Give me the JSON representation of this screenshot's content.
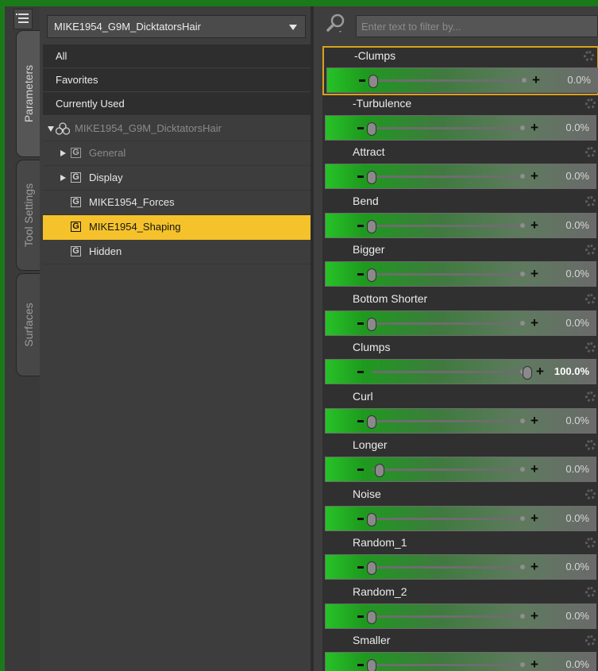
{
  "sidetabs": {
    "tabs": [
      {
        "label": "Parameters",
        "active": true
      },
      {
        "label": "Tool Settings",
        "active": false
      },
      {
        "label": "Surfaces",
        "active": false
      }
    ]
  },
  "left_panel": {
    "node_select": {
      "value": "MIKE1954_G9M_DicktatorsHair"
    },
    "nav": [
      {
        "label": "All"
      },
      {
        "label": "Favorites"
      },
      {
        "label": "Currently Used"
      }
    ],
    "tree": {
      "root": {
        "label": "MIKE1954_G9M_DicktatorsHair"
      },
      "groups": [
        {
          "label": "General",
          "expandable": true,
          "dim": true,
          "selected": false
        },
        {
          "label": "Display",
          "expandable": true,
          "dim": false,
          "selected": false
        },
        {
          "label": "MIKE1954_Forces",
          "expandable": false,
          "dim": false,
          "selected": false
        },
        {
          "label": "MIKE1954_Shaping",
          "expandable": false,
          "dim": false,
          "selected": true
        },
        {
          "label": "Hidden",
          "expandable": false,
          "dim": false,
          "selected": false
        }
      ],
      "group_icon": "G"
    }
  },
  "right_panel": {
    "filter": {
      "placeholder": "Enter text to filter by...",
      "value": ""
    },
    "params": [
      {
        "name": "-Clumps",
        "value": "0.0%",
        "level": 0.0,
        "highlighted": true
      },
      {
        "name": "-Turbulence",
        "value": "0.0%",
        "level": 0.0,
        "highlighted": false
      },
      {
        "name": "Attract",
        "value": "0.0%",
        "level": 0.0,
        "highlighted": false
      },
      {
        "name": "Bend",
        "value": "0.0%",
        "level": 0.0,
        "highlighted": false
      },
      {
        "name": "Bigger",
        "value": "0.0%",
        "level": 0.0,
        "highlighted": false
      },
      {
        "name": "Bottom Shorter",
        "value": "0.0%",
        "level": 0.0,
        "highlighted": false
      },
      {
        "name": "Clumps",
        "value": "100.0%",
        "level": 1.0,
        "highlighted": false
      },
      {
        "name": "Curl",
        "value": "0.0%",
        "level": 0.0,
        "highlighted": false
      },
      {
        "name": "Longer",
        "value": "0.0%",
        "level": 0.05,
        "highlighted": false
      },
      {
        "name": "Noise",
        "value": "0.0%",
        "level": 0.0,
        "highlighted": false
      },
      {
        "name": "Random_1",
        "value": "0.0%",
        "level": 0.0,
        "highlighted": false
      },
      {
        "name": "Random_2",
        "value": "0.0%",
        "level": 0.0,
        "highlighted": false
      },
      {
        "name": "Smaller",
        "value": "0.0%",
        "level": 0.0,
        "highlighted": false
      }
    ]
  },
  "colors": {
    "outer_frame": "#1a7a1a",
    "selection": "#f5c22b",
    "highlight_border": "#d9a21b",
    "slider_green": "#27c227"
  }
}
